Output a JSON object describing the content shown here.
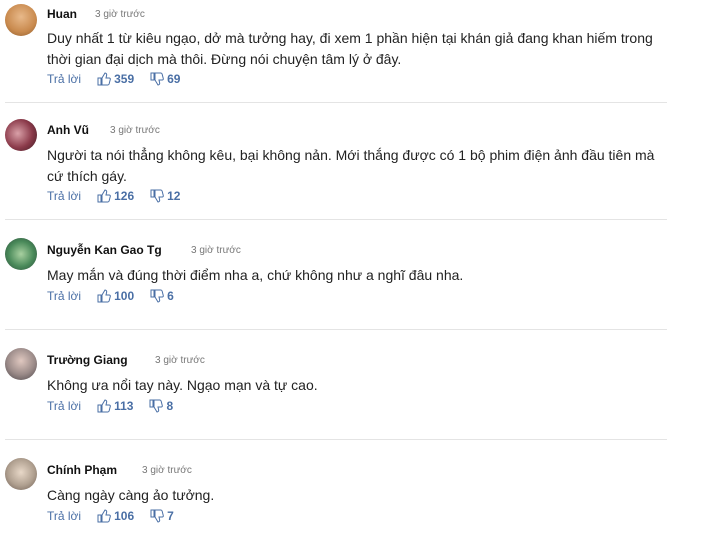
{
  "colors": {
    "link": "#4a6fa5",
    "divider": "#e4e4e4",
    "text": "#222222",
    "muted": "#777777"
  },
  "icons": {
    "like": "thumbs-up-icon",
    "dislike": "thumbs-down-icon"
  },
  "comments": [
    {
      "name": "Huan",
      "time": "3 giờ trước",
      "text": "Duy nhất 1 từ kiêu ngạo, dở mà tưởng hay, đi xem 1 phần hiện tại khán giả đang khan hiếm trong thời gian đại dịch mà thôi. Đừng nói chuyện tâm lý ở đây.",
      "reply_label": "Trả lời",
      "likes": "359",
      "dislikes": "69"
    },
    {
      "name": "Anh Vũ",
      "time": "3 giờ trước",
      "text": "Người ta nói thẳng không kêu, bại không nản. Mới thắng được có 1 bộ phim điện ảnh đầu tiên mà cứ thích gáy.",
      "reply_label": "Trả lời",
      "likes": "126",
      "dislikes": "12"
    },
    {
      "name": "Nguyễn Kan Gao Tg",
      "time": "3 giờ trước",
      "text": "May mắn và đúng thời điểm nha a, chứ không như a nghĩ đâu nha.",
      "reply_label": "Trả lời",
      "likes": "100",
      "dislikes": "6"
    },
    {
      "name": "Trường Giang",
      "time": "3 giờ trước",
      "text": "Không ưa nổi tay này. Ngạo mạn và tự cao.",
      "reply_label": "Trả lời",
      "likes": "113",
      "dislikes": "8"
    },
    {
      "name": "Chính Phạm",
      "time": "3 giờ trước",
      "text": "Càng ngày càng ảo tưởng.",
      "reply_label": "Trả lời",
      "likes": "106",
      "dislikes": "7"
    }
  ]
}
